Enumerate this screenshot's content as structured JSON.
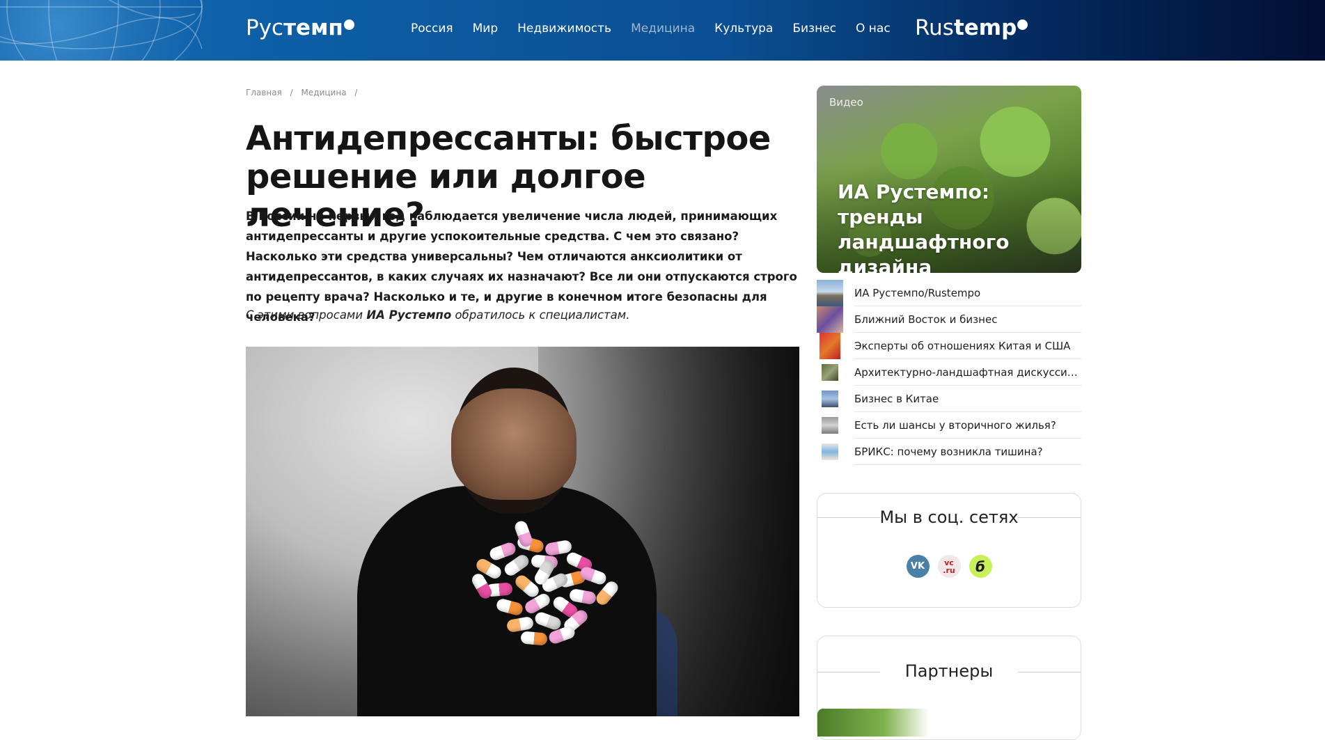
{
  "header": {
    "logo_left": {
      "thin": "Рус",
      "bold": "темп"
    },
    "logo_right": {
      "thin": "Rus",
      "bold": "temp"
    },
    "nav": [
      {
        "label": "Россия",
        "active": false
      },
      {
        "label": "Мир",
        "active": false
      },
      {
        "label": "Недвижимость",
        "active": false
      },
      {
        "label": "Медицина",
        "active": true
      },
      {
        "label": "Культура",
        "active": false
      },
      {
        "label": "Бизнес",
        "active": false
      },
      {
        "label": "О нас",
        "active": false
      }
    ],
    "colors": {
      "gradient_start": "#1b6fb3",
      "gradient_end": "#020f33",
      "active_nav": "#9fb7cf"
    }
  },
  "breadcrumb": {
    "items": [
      "Главная",
      "Медицина"
    ],
    "separator": "/"
  },
  "article": {
    "title": "Антидепрессанты: быстрое решение или долгое лечение?",
    "lead": "В России не первый год наблюдается увеличение числа людей, принимающих антидепрессанты и другие успокоительные средства. С чем это связано? Насколько эти средства универсальны? Чем отличаются анксиолитики от антидепрессантов, в каких случаях их назначают? Все ли они отпускаются строго по рецепту врача? Насколько и те, и другие в конечном итоге безопасны для человека?",
    "note_before": "С этими вопросами ",
    "note_bold": "ИА Рустемпо",
    "note_after": " обратилось к специалистам."
  },
  "sidebar": {
    "video": {
      "label": "Видео",
      "title": "ИА Рустемпо: тренды ландшафтного дизайна"
    },
    "video_list": [
      {
        "title": "ИА Рустемпо/Rustempo",
        "thumb_icon": "city-thumb-icon"
      },
      {
        "title": "Ближний Восток и бизнес",
        "thumb_icon": "street-thumb-icon"
      },
      {
        "title": "Эксперты об отношениях Китая и США",
        "thumb_icon": "flag-thumb-icon"
      },
      {
        "title": "Архитектурно-ландшафтная дискуссия “Г...",
        "thumb_icon": "park-thumb-icon"
      },
      {
        "title": "Бизнес в Китае",
        "thumb_icon": "skyline-thumb-icon"
      },
      {
        "title": "Есть ли шансы у вторичного жилья?",
        "thumb_icon": "building-thumb-icon"
      },
      {
        "title": "БРИКС: почему возникла тишина?",
        "thumb_icon": "sky-thumb-icon"
      }
    ],
    "social": {
      "title": "Мы в соц. сетях",
      "icons": [
        {
          "name": "vk-icon",
          "text": "VK"
        },
        {
          "name": "vc-icon",
          "text": "vc\n.ru"
        },
        {
          "name": "dzen-icon",
          "text": "б"
        }
      ]
    },
    "partners": {
      "title": "Партнеры"
    }
  }
}
